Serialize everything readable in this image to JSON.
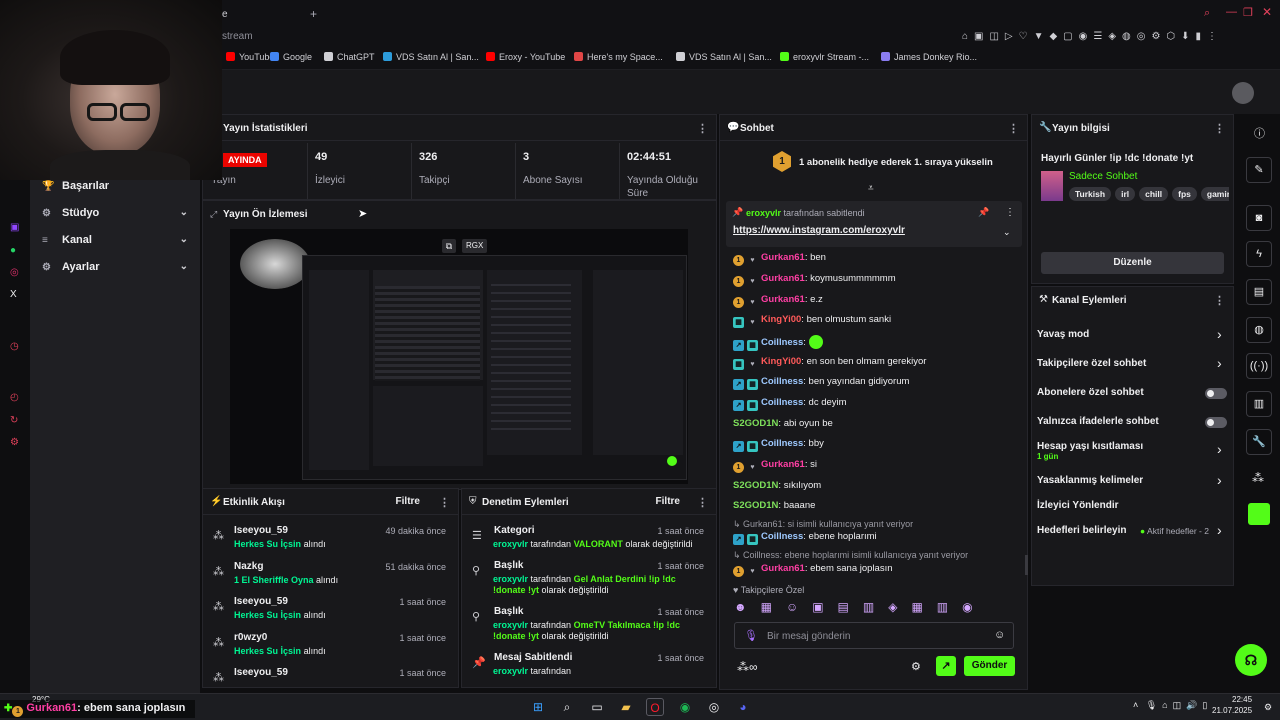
{
  "browser": {
    "tab_title_fragment": "e",
    "url_fragment": "stream",
    "bookmarks": [
      {
        "label": "YouTube",
        "color": "#ff0000"
      },
      {
        "label": "Google",
        "color": "#4285f4"
      },
      {
        "label": "ChatGPT",
        "color": "#cfcfd4"
      },
      {
        "label": "VDS Satın Al | San...",
        "color": "#2d9cdb"
      },
      {
        "label": "Eroxy - YouTube",
        "color": "#ff0000"
      },
      {
        "label": "Here's my Space...",
        "color": "#e04646"
      },
      {
        "label": "VDS Satın Al | San...",
        "color": "#cfcfd4"
      },
      {
        "label": "eroxyvlr Stream -...",
        "color": "#53fc18"
      },
      {
        "label": "James Donkey Rio...",
        "color": "#8a7cf0"
      }
    ]
  },
  "sidemenu": {
    "items": [
      {
        "label": "Başarılar",
        "icon": "trophy-icon",
        "glyph": "🏆",
        "chevron": false
      },
      {
        "label": "Stüdyo",
        "icon": "gear-icon",
        "glyph": "⚙",
        "chevron": true
      },
      {
        "label": "Kanal",
        "icon": "sliders-icon",
        "glyph": "≡",
        "chevron": true
      },
      {
        "label": "Ayarlar",
        "icon": "gear-icon",
        "glyph": "⚙",
        "chevron": true
      }
    ]
  },
  "stats": {
    "title": "Yayın İstatistikleri",
    "live_badge": "AYINDA",
    "items": [
      {
        "value": "",
        "label": "Yayın"
      },
      {
        "value": "49",
        "label": "İzleyici"
      },
      {
        "value": "326",
        "label": "Takipçi"
      },
      {
        "value": "3",
        "label": "Abone Sayısı"
      },
      {
        "value": "02:44:51",
        "label": "Yayında Olduğu Süre"
      }
    ]
  },
  "preview": {
    "title": "Yayın Ön İzlemesi",
    "overlay_label": "RGX"
  },
  "activity": {
    "title": "Etkinlik Akışı",
    "filter": "Filtre",
    "items": [
      {
        "name": "Iseeyou_59",
        "reward": "Herkes Su İçsin",
        "suffix": "alındı",
        "time": "49 dakika önce"
      },
      {
        "name": "Nazkg",
        "reward": "1 El Sheriffle Oyna",
        "suffix": "alındı",
        "time": "51 dakika önce"
      },
      {
        "name": "Iseeyou_59",
        "reward": "Herkes Su İçsin",
        "suffix": "alındı",
        "time": "1 saat önce"
      },
      {
        "name": "r0wzy0",
        "reward": "Herkes Su İçsin",
        "suffix": "alındı",
        "time": "1 saat önce"
      },
      {
        "name": "Iseeyou_59",
        "reward": "",
        "suffix": "",
        "time": "1 saat önce"
      }
    ]
  },
  "moderation": {
    "title": "Denetim Eylemleri",
    "filter": "Filtre",
    "items": [
      {
        "title": "Kategori",
        "icon": "list-icon",
        "user": "eroxyvlr",
        "middle": " tarafından ",
        "value": "VALORANT",
        "rest": " olarak değiştirildi",
        "time": "1 saat önce"
      },
      {
        "title": "Başlık",
        "icon": "text-icon",
        "user": "eroxyvlr",
        "middle": " tarafından ",
        "value": "Gel Anlat Derdini !ip !dc !donate !yt",
        "rest": " olarak değiştirildi",
        "time": "1 saat önce"
      },
      {
        "title": "Başlık",
        "icon": "text-icon",
        "user": "eroxyvlr",
        "middle": " tarafından ",
        "value": "OmeTV Takılmaca !ip !dc !donate !yt",
        "rest": " olarak değiştirildi",
        "time": "1 saat önce"
      },
      {
        "title": "Mesaj Sabitlendi",
        "icon": "pin-icon",
        "user": "eroxyvlr",
        "middle": " tarafından",
        "value": "",
        "rest": "",
        "time": "1 saat önce"
      }
    ]
  },
  "chat": {
    "title": "Sohbet",
    "gift_banner": "1 abonelik hediye ederek 1. sıraya yükselin",
    "gift_rank": "1",
    "pinned_by": "eroxyvlr",
    "pinned_suffix": " tarafından sabitlendi",
    "pinned_link": "https://www.instagram.com/eroxyvlr",
    "messages": [
      {
        "user": "Gurkan61",
        "text": "ben",
        "badges": [
          "gold",
          "heart"
        ],
        "color": "pink"
      },
      {
        "user": "Gurkan61",
        "text": "koymusummmmmm",
        "badges": [
          "gold",
          "heart"
        ],
        "color": "pink"
      },
      {
        "user": "Gurkan61",
        "text": "e.z",
        "badges": [
          "gold",
          "heart"
        ],
        "color": "pink"
      },
      {
        "user": "KingYi00",
        "text": "ben olmustum sanki",
        "badges": [
          "teal",
          "heart"
        ],
        "color": "red"
      },
      {
        "user": "Coillness",
        "text": "",
        "badges": [
          "blue",
          "teal"
        ],
        "color": "blue",
        "emote": true
      },
      {
        "user": "KingYi00",
        "text": "en son ben olmam gerekiyor",
        "badges": [
          "teal",
          "heart"
        ],
        "color": "red"
      },
      {
        "user": "Coillness",
        "text": "ben yayından gidiyorum",
        "badges": [
          "blue",
          "teal"
        ],
        "color": "blue"
      },
      {
        "user": "Coillness",
        "text": "dc deyim",
        "badges": [
          "blue",
          "teal"
        ],
        "color": "blue"
      },
      {
        "user": "S2GOD1N",
        "text": "abi oyun be",
        "badges": [],
        "color": "green"
      },
      {
        "user": "Coillness",
        "text": "bby",
        "badges": [
          "blue",
          "teal"
        ],
        "color": "blue"
      },
      {
        "user": "Gurkan61",
        "text": "si",
        "badges": [
          "gold",
          "heart"
        ],
        "color": "pink"
      },
      {
        "user": "S2GOD1N",
        "text": "sıkılıyom",
        "badges": [],
        "color": "green"
      },
      {
        "user": "S2GOD1N",
        "text": "baaane",
        "badges": [],
        "color": "green"
      }
    ],
    "reply1_context": "Gurkan61: si isimli kullanıcıya yanıt veriyor",
    "reply1": {
      "user": "Coillness",
      "text": "ebene hoplarımi"
    },
    "reply2_context": "Coillness: ebene hoplarımi isimli kullanıcıya yanıt veriyor",
    "reply2": {
      "user": "Gurkan61",
      "text": "ebem sana joplasın"
    },
    "follower_only_label": "Takipçilere Özel",
    "input_placeholder": "Bir mesaj gönderin",
    "send_label": "Gönder"
  },
  "stream_info": {
    "title": "Yayın bilgisi",
    "stream_title": "Hayırlı Günler !ip !dc !donate !yt",
    "category": "Sadece Sohbet",
    "tags": [
      "Turkish",
      "irl",
      "chill",
      "fps",
      "gamir"
    ],
    "edit_label": "Düzenle"
  },
  "channel_actions": {
    "title": "Kanal Eylemleri",
    "rows": [
      {
        "label": "Yavaş mod",
        "control": "chevron"
      },
      {
        "label": "Takipçilere özel sohbet",
        "control": "chevron"
      },
      {
        "label": "Abonelere özel sohbet",
        "control": "toggle"
      },
      {
        "label": "Yalnızca ifadelerle sohbet",
        "control": "toggle"
      },
      {
        "label": "Hesap yaşı kısıtlaması",
        "control": "chevron",
        "sub": "1 gün"
      },
      {
        "label": "Yasaklanmış kelimeler",
        "control": "chevron"
      },
      {
        "label": "İzleyici Yönlendir",
        "control": "none"
      },
      {
        "label": "Hedefleri belirleyin",
        "control": "chevron",
        "extra": "Aktif hedefler - 2"
      }
    ]
  },
  "overlay_bottom": {
    "weather": "29°C",
    "caption_user": "Gurkan61",
    "caption_text": ": ebem sana joplasın"
  },
  "taskbar": {
    "time": "22:45",
    "date": "21.07.2025"
  }
}
